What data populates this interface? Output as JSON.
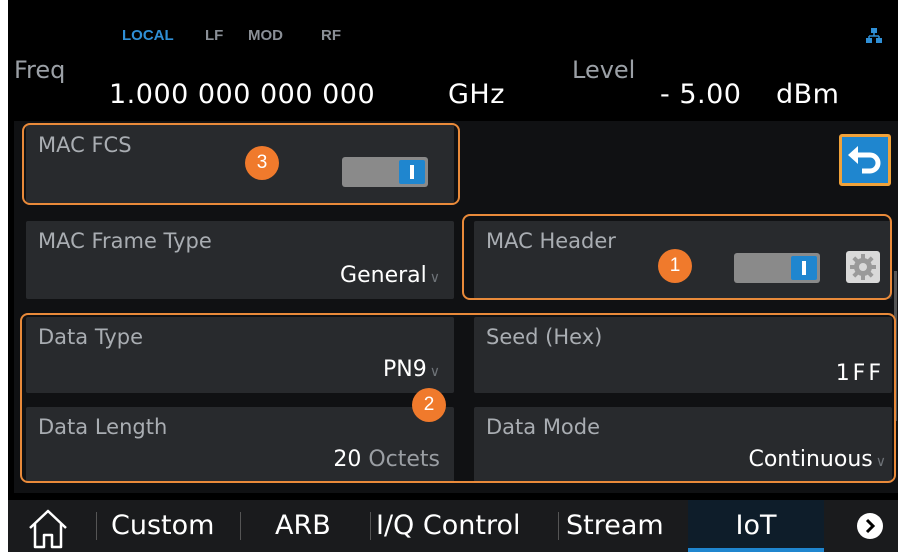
{
  "status": {
    "local": "LOCAL",
    "lf": "LF",
    "mod": "MOD",
    "rf": "RF",
    "icon": "network-icon"
  },
  "freq": {
    "label": "Freq",
    "value": "1.000 000 000 000",
    "unit": "GHz"
  },
  "level": {
    "label": "Level",
    "value": "- 5.00",
    "unit": "dBm"
  },
  "mac_fcs": {
    "label": "MAC FCS",
    "state": "on"
  },
  "back_icon": "back-arrow-icon",
  "mac_frame_type": {
    "label": "MAC Frame Type",
    "value": "General"
  },
  "mac_header": {
    "label": "MAC Header",
    "state": "on"
  },
  "data_type": {
    "label": "Data Type",
    "value": "PN9"
  },
  "seed": {
    "label": "Seed (Hex)",
    "value": "1FF"
  },
  "data_length": {
    "label": "Data Length",
    "value": "20",
    "unit": "Octets"
  },
  "data_mode": {
    "label": "Data Mode",
    "value": "Continuous"
  },
  "callouts": {
    "one": "1",
    "two": "2",
    "three": "3"
  },
  "tabs": [
    {
      "label": "Custom"
    },
    {
      "label": "ARB"
    },
    {
      "label": "I/Q Control"
    },
    {
      "label": "Stream"
    },
    {
      "label": "IoT"
    }
  ],
  "colors": {
    "accent": "#1f86cf",
    "highlight": "#e98a3a",
    "panel": "#282a2d"
  }
}
